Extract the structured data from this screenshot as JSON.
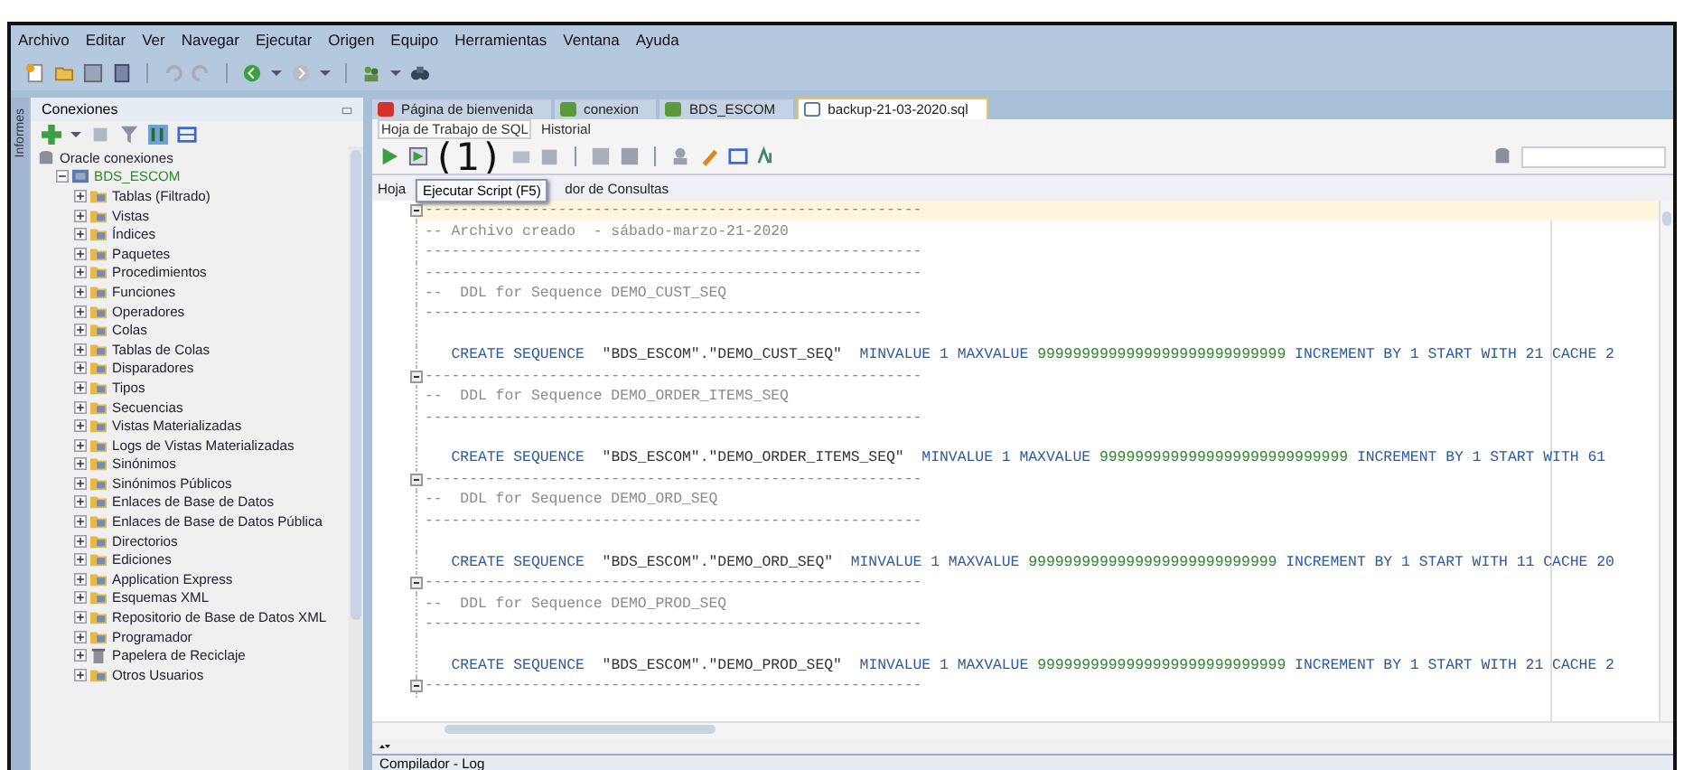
{
  "menu": [
    "Archivo",
    "Editar",
    "Ver",
    "Navegar",
    "Ejecutar",
    "Origen",
    "Equipo",
    "Herramientas",
    "Ventana",
    "Ayuda"
  ],
  "connections_panel": {
    "title": "Conexiones",
    "side_tab": "Informes",
    "tree": [
      {
        "label": "Oracle conexiones",
        "kind": "root",
        "children": [
          {
            "label": "BDS_ESCOM",
            "kind": "connection",
            "expanded": true,
            "children": [
              {
                "label": "Tablas (Filtrado)",
                "kind": "folder",
                "expanded": false
              },
              {
                "label": "Vistas",
                "kind": "folder",
                "expanded": false
              },
              {
                "label": "Índices",
                "kind": "folder",
                "expanded": false
              },
              {
                "label": "Paquetes",
                "kind": "folder",
                "expanded": false
              },
              {
                "label": "Procedimientos",
                "kind": "folder",
                "expanded": false
              },
              {
                "label": "Funciones",
                "kind": "folder",
                "expanded": false
              },
              {
                "label": "Operadores",
                "kind": "folder",
                "expanded": false
              },
              {
                "label": "Colas",
                "kind": "folder",
                "expanded": false
              },
              {
                "label": "Tablas de Colas",
                "kind": "folder",
                "expanded": false
              },
              {
                "label": "Disparadores",
                "kind": "folder",
                "expanded": false
              },
              {
                "label": "Tipos",
                "kind": "folder",
                "expanded": false
              },
              {
                "label": "Secuencias",
                "kind": "folder",
                "expanded": false
              },
              {
                "label": "Vistas Materializadas",
                "kind": "folder",
                "expanded": false
              },
              {
                "label": "Logs de Vistas Materializadas",
                "kind": "folder",
                "expanded": false
              },
              {
                "label": "Sinónimos",
                "kind": "folder",
                "expanded": false
              },
              {
                "label": "Sinónimos Públicos",
                "kind": "folder",
                "expanded": false
              },
              {
                "label": "Enlaces de Base de Datos",
                "kind": "folder",
                "expanded": false
              },
              {
                "label": "Enlaces de Base de Datos Pública",
                "kind": "folder",
                "expanded": false
              },
              {
                "label": "Directorios",
                "kind": "folder",
                "expanded": false
              },
              {
                "label": "Ediciones",
                "kind": "folder",
                "expanded": false
              },
              {
                "label": "Application Express",
                "kind": "folder",
                "expanded": false
              },
              {
                "label": "Esquemas XML",
                "kind": "folder",
                "expanded": false
              },
              {
                "label": "Repositorio de Base de Datos XML",
                "kind": "folder",
                "expanded": false
              },
              {
                "label": "Programador",
                "kind": "folder",
                "expanded": false
              },
              {
                "label": "Papelera de Reciclaje",
                "kind": "trash",
                "expanded": false
              },
              {
                "label": "Otros Usuarios",
                "kind": "folder",
                "expanded": false
              }
            ]
          }
        ]
      }
    ]
  },
  "editor_tabs": [
    {
      "label": "Página de bienvenida",
      "kind": "welcome",
      "selected": false
    },
    {
      "label": "conexion",
      "kind": "connection",
      "selected": false
    },
    {
      "label": "BDS_ESCOM",
      "kind": "connection",
      "selected": false
    },
    {
      "label": "backup-21-03-2020.sql",
      "kind": "file",
      "selected": true
    }
  ],
  "sub_tabs": [
    {
      "label": "Hoja de Trabajo de SQL",
      "selected": true
    },
    {
      "label": "Historial",
      "selected": false
    }
  ],
  "annotation": "(1)",
  "worksheet_tabs": [
    "Hoja",
    "dor de Consultas"
  ],
  "tooltip": "Ejecutar Script (F5)",
  "code_lines": [
    {
      "fold": true,
      "current": true,
      "segments": [
        {
          "kind": "comment",
          "text": "--------------------------------------------------------"
        }
      ]
    },
    {
      "fold": false,
      "current": false,
      "segments": [
        {
          "kind": "comment",
          "text": "-- Archivo creado  - sábado-marzo-21-2020"
        }
      ]
    },
    {
      "fold": false,
      "current": false,
      "segments": [
        {
          "kind": "comment",
          "text": "--------------------------------------------------------"
        }
      ]
    },
    {
      "fold": false,
      "current": false,
      "segments": [
        {
          "kind": "comment",
          "text": "--------------------------------------------------------"
        }
      ]
    },
    {
      "fold": false,
      "current": false,
      "segments": [
        {
          "kind": "comment",
          "text": "--  DDL for Sequence DEMO_CUST_SEQ"
        }
      ]
    },
    {
      "fold": false,
      "current": false,
      "segments": [
        {
          "kind": "comment",
          "text": "--------------------------------------------------------"
        }
      ]
    },
    {
      "fold": false,
      "current": false
    },
    {
      "fold": false,
      "current": false,
      "segments": [
        {
          "kind": "keyword",
          "text": "   CREATE SEQUENCE  "
        },
        {
          "kind": "string",
          "text": "\"BDS_ESCOM\".\"DEMO_CUST_SEQ\"  "
        },
        {
          "kind": "keyword",
          "text": "MINVALUE 1 MAXVALUE "
        },
        {
          "kind": "number",
          "text": "9999999999999999999999999999"
        },
        {
          "kind": "keyword",
          "text": " INCREMENT BY 1 START WITH 21 CACHE 2"
        }
      ]
    },
    {
      "fold": true,
      "current": false,
      "segments": [
        {
          "kind": "comment",
          "text": "--------------------------------------------------------"
        }
      ]
    },
    {
      "fold": false,
      "current": false,
      "segments": [
        {
          "kind": "comment",
          "text": "--  DDL for Sequence DEMO_ORDER_ITEMS_SEQ"
        }
      ]
    },
    {
      "fold": false,
      "current": false,
      "segments": [
        {
          "kind": "comment",
          "text": "--------------------------------------------------------"
        }
      ]
    },
    {
      "fold": false,
      "current": false
    },
    {
      "fold": false,
      "current": false,
      "segments": [
        {
          "kind": "keyword",
          "text": "   CREATE SEQUENCE  "
        },
        {
          "kind": "string",
          "text": "\"BDS_ESCOM\".\"DEMO_ORDER_ITEMS_SEQ\"  "
        },
        {
          "kind": "keyword",
          "text": "MINVALUE 1 MAXVALUE "
        },
        {
          "kind": "number",
          "text": "9999999999999999999999999999"
        },
        {
          "kind": "keyword",
          "text": " INCREMENT BY 1 START WITH 61"
        }
      ]
    },
    {
      "fold": true,
      "current": false,
      "segments": [
        {
          "kind": "comment",
          "text": "--------------------------------------------------------"
        }
      ]
    },
    {
      "fold": false,
      "current": false,
      "segments": [
        {
          "kind": "comment",
          "text": "--  DDL for Sequence DEMO_ORD_SEQ"
        }
      ]
    },
    {
      "fold": false,
      "current": false,
      "segments": [
        {
          "kind": "comment",
          "text": "--------------------------------------------------------"
        }
      ]
    },
    {
      "fold": false,
      "current": false
    },
    {
      "fold": false,
      "current": false,
      "segments": [
        {
          "kind": "keyword",
          "text": "   CREATE SEQUENCE  "
        },
        {
          "kind": "string",
          "text": "\"BDS_ESCOM\".\"DEMO_ORD_SEQ\"  "
        },
        {
          "kind": "keyword",
          "text": "MINVALUE 1 MAXVALUE "
        },
        {
          "kind": "number",
          "text": "9999999999999999999999999999"
        },
        {
          "kind": "keyword",
          "text": " INCREMENT BY 1 START WITH 11 CACHE 20"
        }
      ]
    },
    {
      "fold": true,
      "current": false,
      "segments": [
        {
          "kind": "comment",
          "text": "--------------------------------------------------------"
        }
      ]
    },
    {
      "fold": false,
      "current": false,
      "segments": [
        {
          "kind": "comment",
          "text": "--  DDL for Sequence DEMO_PROD_SEQ"
        }
      ]
    },
    {
      "fold": false,
      "current": false,
      "segments": [
        {
          "kind": "comment",
          "text": "--------------------------------------------------------"
        }
      ]
    },
    {
      "fold": false,
      "current": false
    },
    {
      "fold": false,
      "current": false,
      "segments": [
        {
          "kind": "keyword",
          "text": "   CREATE SEQUENCE  "
        },
        {
          "kind": "string",
          "text": "\"BDS_ESCOM\".\"DEMO_PROD_SEQ\"  "
        },
        {
          "kind": "keyword",
          "text": "MINVALUE 1 MAXVALUE "
        },
        {
          "kind": "number",
          "text": "9999999999999999999999999999"
        },
        {
          "kind": "keyword",
          "text": " INCREMENT BY 1 START WITH 21 CACHE 2"
        }
      ]
    },
    {
      "fold": true,
      "current": false,
      "segments": [
        {
          "kind": "comment",
          "text": "--------------------------------------------------------"
        }
      ]
    }
  ],
  "bottom_panel": {
    "title": "Compilador - Log"
  }
}
